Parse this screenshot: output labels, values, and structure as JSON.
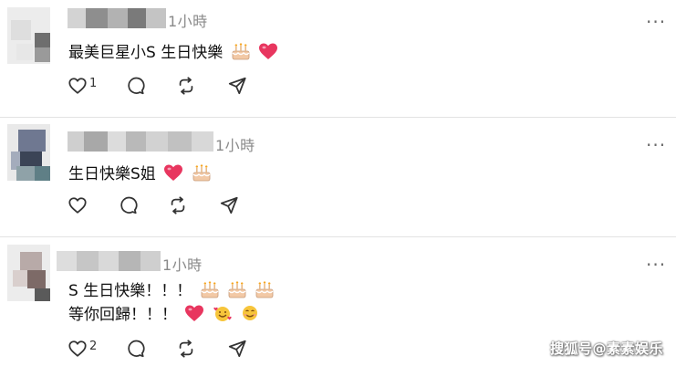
{
  "comments": [
    {
      "time": "1小時",
      "line1": "最美巨星小S 生日快樂",
      "line2": "",
      "like_count": "1"
    },
    {
      "time": "1小時",
      "line1": "生日快樂S姐",
      "line2": "",
      "like_count": ""
    },
    {
      "time": "1小時",
      "line1": "S 生日快樂！！！",
      "line2": "等你回歸！！！",
      "like_count": "2"
    }
  ],
  "more_icon": "···",
  "icons": [
    "heart-icon",
    "comment-icon",
    "repost-icon",
    "share-icon",
    "more-icon",
    "cake-emoji",
    "pink-heart-emoji",
    "smiling-hearts-emoji",
    "smiling-face-emoji"
  ],
  "colors": {
    "heart_pink": "#e8365f",
    "cake": "#f2c9a6",
    "muted": "#8a8a8a",
    "divider": "#e3e3e3"
  },
  "watermark": "搜狐号@素素娱乐"
}
